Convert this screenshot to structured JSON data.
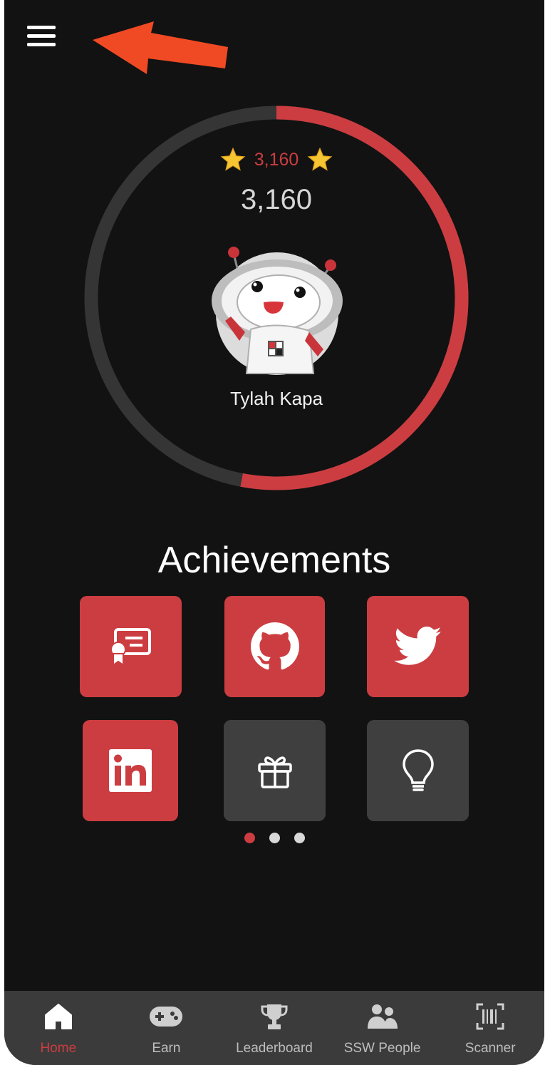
{
  "header": {
    "menu_icon": "hamburger-menu-icon"
  },
  "profile": {
    "points_small": "3,160",
    "points_large": "3,160",
    "name": "Tylah Kapa",
    "progress_fraction": 0.53,
    "colors": {
      "accent": "#cc3d41",
      "track": "#353535"
    }
  },
  "achievements": {
    "title": "Achievements",
    "items": [
      {
        "icon": "certificate-icon",
        "earned": true
      },
      {
        "icon": "github-icon",
        "earned": true
      },
      {
        "icon": "twitter-icon",
        "earned": true
      },
      {
        "icon": "linkedin-icon",
        "earned": true
      },
      {
        "icon": "gift-icon",
        "earned": false
      },
      {
        "icon": "lightbulb-icon",
        "earned": false
      }
    ],
    "page_count": 3,
    "active_page": 1
  },
  "tabs": [
    {
      "label": "Home",
      "icon": "home-icon",
      "active": true
    },
    {
      "label": "Earn",
      "icon": "gamepad-icon",
      "active": false
    },
    {
      "label": "Leaderboard",
      "icon": "trophy-icon",
      "active": false
    },
    {
      "label": "SSW People",
      "icon": "people-icon",
      "active": false
    },
    {
      "label": "Scanner",
      "icon": "barcode-scanner-icon",
      "active": false
    }
  ]
}
